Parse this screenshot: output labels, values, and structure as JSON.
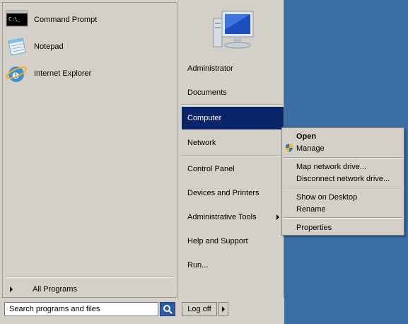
{
  "pinned_programs": [
    {
      "label": "Command Prompt",
      "icon": "command-prompt-icon"
    },
    {
      "label": "Notepad",
      "icon": "notepad-icon"
    },
    {
      "label": "Internet Explorer",
      "icon": "internet-explorer-icon"
    }
  ],
  "all_programs_label": "All Programs",
  "search": {
    "placeholder": "Search programs and files"
  },
  "logoff_label": "Log off",
  "right_items": [
    {
      "label": "Administrator"
    },
    {
      "label": "Documents"
    },
    {
      "label": "Computer",
      "selected": true
    },
    {
      "label": "Network"
    },
    {
      "label": "Control Panel"
    },
    {
      "label": "Devices and Printers"
    },
    {
      "label": "Administrative Tools",
      "has_submenu": true
    },
    {
      "label": "Help and Support"
    },
    {
      "label": "Run..."
    }
  ],
  "context_menu": {
    "items": [
      {
        "label": "Open",
        "bold": true
      },
      {
        "label": "Manage",
        "icon": "uac-shield-icon"
      },
      {
        "label": "Map network drive..."
      },
      {
        "label": "Disconnect network drive..."
      },
      {
        "label": "Show on Desktop"
      },
      {
        "label": "Rename"
      },
      {
        "label": "Properties"
      }
    ]
  },
  "colors": {
    "desktop": "#3a6ea5",
    "menu_bg": "#d4d0c8",
    "selection": "#0a246a"
  }
}
